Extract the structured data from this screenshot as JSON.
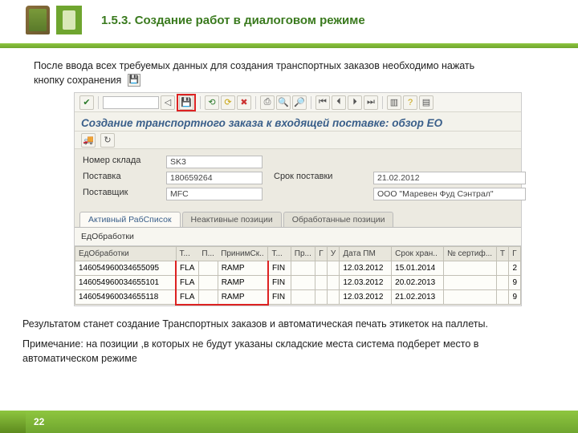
{
  "header": {
    "title": "1.5.3. Создание работ в диалоговом режиме"
  },
  "body": {
    "intro_line1": "После ввода всех требуемых данных для создания транспортных заказов необходимо нажать",
    "intro_line2": "кнопку сохранения",
    "result": "Результатом станет создание Транспортных заказов и автоматическая печать этикеток на паллеты.",
    "note": "Примечание: на позиции ,в которых не будут указаны складские места система подберет место в автоматическом режиме"
  },
  "sap": {
    "window_title": "Создание транспортного заказа к входящей поставке: обзор ЕО",
    "fields": {
      "warehouse_label": "Номер склада",
      "warehouse_val": "SK3",
      "delivery_label": "Поставка",
      "delivery_val": "180659264",
      "delivery_date_label": "Срок поставки",
      "delivery_date_val": "21.02.2012",
      "supplier_label": "Поставщик",
      "supplier_val": "MFC",
      "supplier_name": "ООО \"Маревен Фуд Сэнтрал\""
    },
    "tabs": {
      "active": "Активный РабСписок",
      "inactive": "Неактивные позиции",
      "processed": "Обработанные позиции"
    },
    "table": {
      "title": "ЕдОбработки",
      "cols": {
        "edobr": "ЕдОбработки",
        "t1": "Т...",
        "p": "П...",
        "prin": "ПринимСк..",
        "t2": "Т...",
        "pr": "Пр...",
        "g": "Г",
        "u": "У",
        "datapm": "Дата ПМ",
        "srok": "Срок хран..",
        "sert": "№ сертиф...",
        "tg": "Т",
        "g2": "Г"
      },
      "rows": [
        {
          "edobr": "146054960034655095",
          "t1": "FLA",
          "prin": "RAMP",
          "t2": "FIN",
          "datapm": "12.03.2012",
          "srok": "15.01.2014",
          "last": "2"
        },
        {
          "edobr": "146054960034655101",
          "t1": "FLA",
          "prin": "RAMP",
          "t2": "FIN",
          "datapm": "12.03.2012",
          "srok": "20.02.2013",
          "last": "9"
        },
        {
          "edobr": "146054960034655118",
          "t1": "FLA",
          "prin": "RAMP",
          "t2": "FIN",
          "datapm": "12.03.2012",
          "srok": "21.02.2013",
          "last": "9"
        }
      ]
    }
  },
  "footer": {
    "page": "22"
  },
  "icons": {
    "check": "✔",
    "save": "💾",
    "back": "⏴",
    "fwd": "⏵",
    "cancel": "✖",
    "print": "⎙",
    "find": "🔍"
  }
}
